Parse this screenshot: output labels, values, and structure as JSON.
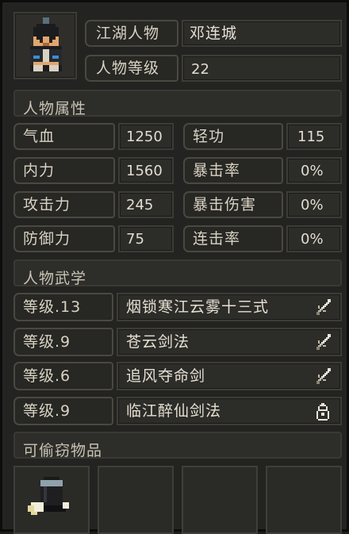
{
  "character": {
    "portrait_icon": "swordsman-portrait-icon",
    "name_label": "江湖人物",
    "name": "邓连城",
    "level_label": "人物等级",
    "level": "22"
  },
  "attributes": {
    "section_title": "人物属性",
    "rows": [
      {
        "left_label": "气血",
        "left_value": "1250",
        "right_label": "轻功",
        "right_value": "115"
      },
      {
        "left_label": "内力",
        "left_value": "1560",
        "right_label": "暴击率",
        "right_value": "0%"
      },
      {
        "left_label": "攻击力",
        "left_value": "245",
        "right_label": "暴击伤害",
        "right_value": "0%"
      },
      {
        "left_label": "防御力",
        "left_value": "75",
        "right_label": "连击率",
        "right_value": "0%"
      }
    ]
  },
  "martial_arts": {
    "section_title": "人物武学",
    "skills": [
      {
        "level": "等级.13",
        "name": "烟锁寒江云雾十三式",
        "icon": "sword-icon"
      },
      {
        "level": "等级.9",
        "name": "苍云剑法",
        "icon": "sword-icon"
      },
      {
        "level": "等级.6",
        "name": "追风夺命剑",
        "icon": "sword-icon"
      },
      {
        "level": "等级.9",
        "name": "临江醉仙剑法",
        "icon": "gourd-icon"
      }
    ]
  },
  "stealable": {
    "section_title": "可偷窃物品",
    "slots": [
      {
        "icon": "hat-scroll-item-icon"
      },
      {
        "icon": "empty-slot"
      },
      {
        "icon": "empty-slot"
      },
      {
        "icon": "empty-slot"
      }
    ]
  }
}
